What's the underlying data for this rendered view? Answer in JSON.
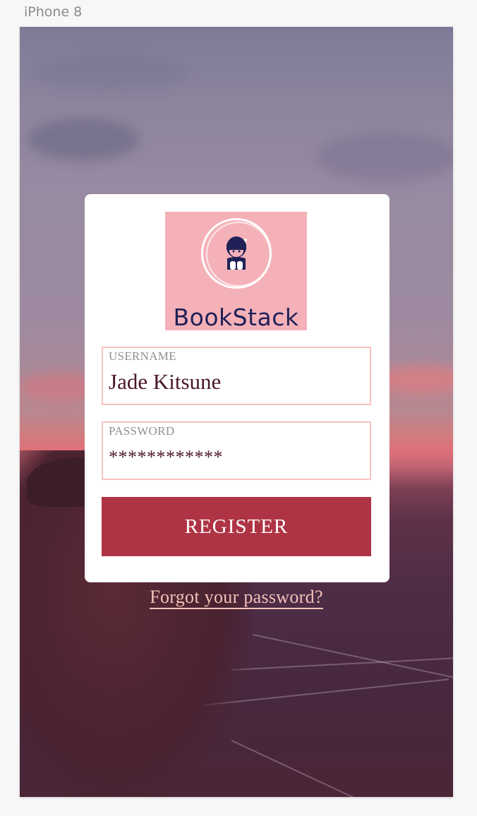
{
  "artboard": {
    "label": "iPhone 8"
  },
  "logo": {
    "text": "BookStack",
    "icon": "reading-girl-icon",
    "background": "#f5b1b8",
    "text_color": "#1f2157"
  },
  "form": {
    "username": {
      "label": "USERNAME",
      "value": "Jade Kitsune"
    },
    "password": {
      "label": "PASSWORD",
      "value": "************"
    },
    "register_label": "REGISTER",
    "forgot_label": "Forgot your password?"
  },
  "colors": {
    "button": "#ae3445",
    "field_border": "#f6c3c0",
    "link": "#f4c2b8",
    "value_text": "#4a1726"
  }
}
